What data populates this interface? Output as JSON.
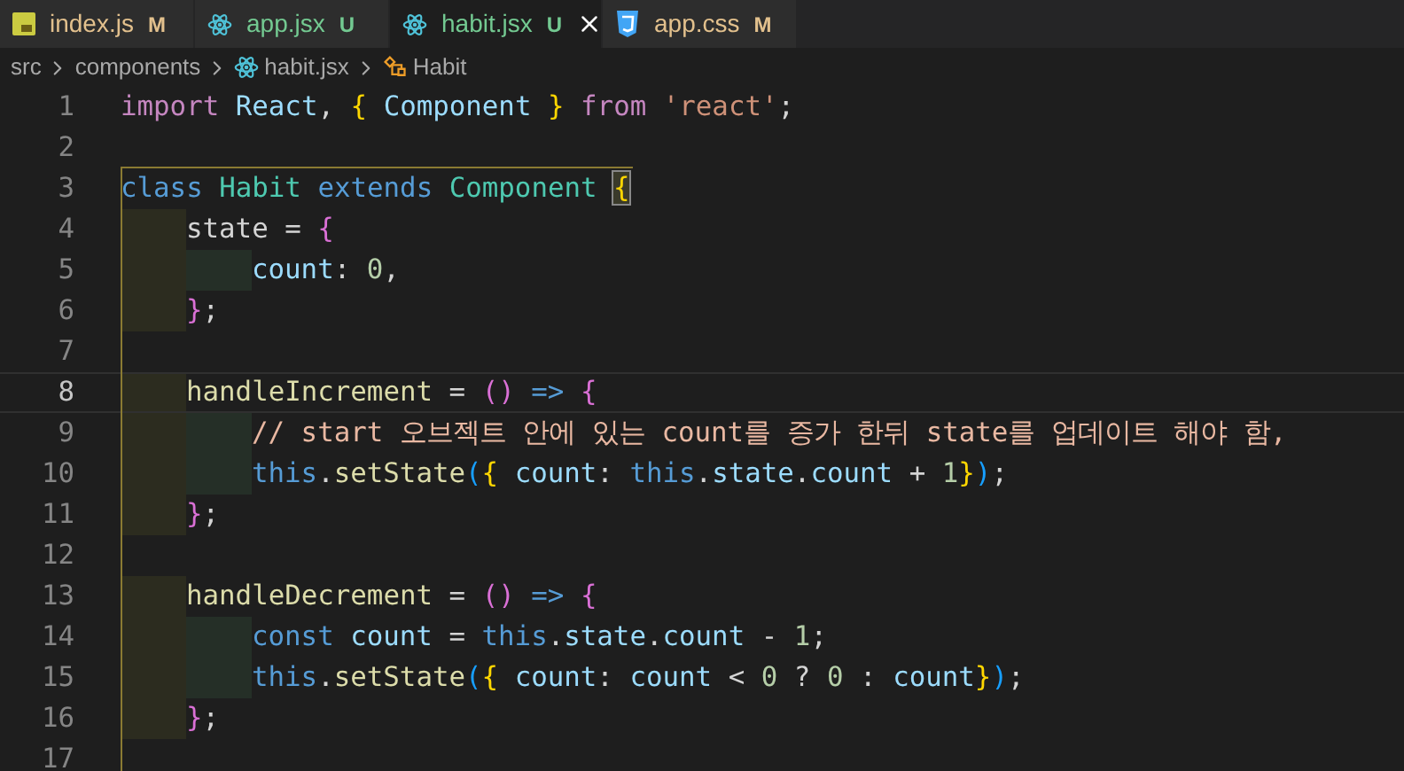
{
  "tabs": [
    {
      "label": "index.js",
      "status": "M",
      "color": "#e2c08d",
      "kind": "js",
      "selected": false
    },
    {
      "label": "app.jsx",
      "status": "U",
      "color": "#73c991",
      "kind": "react",
      "selected": false
    },
    {
      "label": "habit.jsx",
      "status": "U",
      "color": "#73c991",
      "kind": "react",
      "selected": true
    },
    {
      "label": "app.css",
      "status": "M",
      "color": "#e2c08d",
      "kind": "css",
      "selected": false
    }
  ],
  "breadcrumbs": [
    {
      "label": "src",
      "kind": "folder"
    },
    {
      "label": "components",
      "kind": "folder"
    },
    {
      "label": "habit.jsx",
      "kind": "react"
    },
    {
      "label": "Habit",
      "kind": "class"
    }
  ],
  "lines": [
    {
      "number": "1",
      "current": false,
      "tokens": [
        {
          "t": "import ",
          "kind": "kw"
        },
        {
          "t": "React",
          "kind": "var"
        },
        {
          "t": ", ",
          "kind": "pl"
        },
        {
          "t": "{ ",
          "kind": "b1"
        },
        {
          "t": "Component ",
          "kind": "var"
        },
        {
          "t": "} ",
          "kind": "b1"
        },
        {
          "t": "from ",
          "kind": "kw"
        },
        {
          "t": "'react'",
          "kind": "str"
        },
        {
          "t": ";",
          "kind": "pl"
        }
      ]
    },
    {
      "number": "2",
      "current": false
    },
    {
      "number": "3",
      "current": false,
      "tokens": [
        {
          "t": "class ",
          "kind": "st"
        },
        {
          "t": "Habit ",
          "kind": "ty"
        },
        {
          "t": "extends ",
          "kind": "st"
        },
        {
          "t": "Component ",
          "kind": "ty"
        },
        {
          "t": "{",
          "kind": "b1",
          "boxed": true
        }
      ]
    },
    {
      "number": "4",
      "current": false,
      "guides": [
        {
          "color": "#2c2c1f"
        }
      ],
      "tokens": [
        {
          "t": "state = ",
          "kind": "pl"
        },
        {
          "t": "{",
          "kind": "b2"
        }
      ]
    },
    {
      "number": "5",
      "current": false,
      "guides": [
        {
          "color": "#2c2c1f"
        },
        {
          "color": "#252f27"
        }
      ],
      "tokens": [
        {
          "t": "count",
          "kind": "var"
        },
        {
          "t": ": ",
          "kind": "pl"
        },
        {
          "t": "0",
          "kind": "num"
        },
        {
          "t": ",",
          "kind": "pl"
        }
      ]
    },
    {
      "number": "6",
      "current": false,
      "guides": [
        {
          "color": "#2c2c1f"
        }
      ],
      "tokens": [
        {
          "t": "}",
          "kind": "b2"
        },
        {
          "t": ";",
          "kind": "pl"
        }
      ]
    },
    {
      "number": "7",
      "current": false
    },
    {
      "number": "8",
      "current": true,
      "guides": [
        {
          "color": "#2c2c1f"
        }
      ],
      "tokens": [
        {
          "t": "handleIncrement",
          "kind": "fn"
        },
        {
          "t": " = ",
          "kind": "pl"
        },
        {
          "t": "() ",
          "kind": "b2"
        },
        {
          "t": "=> ",
          "kind": "st"
        },
        {
          "t": "{",
          "kind": "b2"
        }
      ]
    },
    {
      "number": "9",
      "current": false,
      "guides": [
        {
          "color": "#2c2c1f"
        },
        {
          "color": "#252f27"
        }
      ],
      "tokens": [
        {
          "t": "// start 오브젝트 안에 있는 count를 증가 한뒤 state를 업데이트 해야 함,",
          "kind": "cm"
        }
      ]
    },
    {
      "number": "10",
      "current": false,
      "guides": [
        {
          "color": "#2c2c1f"
        },
        {
          "color": "#252f27"
        }
      ],
      "tokens": [
        {
          "t": "this",
          "kind": "st"
        },
        {
          "t": ".",
          "kind": "pl"
        },
        {
          "t": "setState",
          "kind": "fn"
        },
        {
          "t": "(",
          "kind": "b3"
        },
        {
          "t": "{ ",
          "kind": "b1"
        },
        {
          "t": "count",
          "kind": "var"
        },
        {
          "t": ": ",
          "kind": "pl"
        },
        {
          "t": "this",
          "kind": "st"
        },
        {
          "t": ".",
          "kind": "pl"
        },
        {
          "t": "state",
          "kind": "var"
        },
        {
          "t": ".",
          "kind": "pl"
        },
        {
          "t": "count",
          "kind": "var"
        },
        {
          "t": " + ",
          "kind": "pl"
        },
        {
          "t": "1",
          "kind": "num"
        },
        {
          "t": "}",
          "kind": "b1"
        },
        {
          "t": ")",
          "kind": "b3"
        },
        {
          "t": ";",
          "kind": "pl"
        }
      ]
    },
    {
      "number": "11",
      "current": false,
      "guides": [
        {
          "color": "#2c2c1f"
        }
      ],
      "tokens": [
        {
          "t": "}",
          "kind": "b2"
        },
        {
          "t": ";",
          "kind": "pl"
        }
      ]
    },
    {
      "number": "12",
      "current": false
    },
    {
      "number": "13",
      "current": false,
      "guides": [
        {
          "color": "#2c2c1f"
        }
      ],
      "tokens": [
        {
          "t": "handleDecrement",
          "kind": "fn"
        },
        {
          "t": " = ",
          "kind": "pl"
        },
        {
          "t": "() ",
          "kind": "b2"
        },
        {
          "t": "=> ",
          "kind": "st"
        },
        {
          "t": "{",
          "kind": "b2"
        }
      ]
    },
    {
      "number": "14",
      "current": false,
      "guides": [
        {
          "color": "#2c2c1f"
        },
        {
          "color": "#252f27"
        }
      ],
      "tokens": [
        {
          "t": "const ",
          "kind": "st"
        },
        {
          "t": "count",
          "kind": "var"
        },
        {
          "t": " = ",
          "kind": "pl"
        },
        {
          "t": "this",
          "kind": "st"
        },
        {
          "t": ".",
          "kind": "pl"
        },
        {
          "t": "state",
          "kind": "var"
        },
        {
          "t": ".",
          "kind": "pl"
        },
        {
          "t": "count",
          "kind": "var"
        },
        {
          "t": " - ",
          "kind": "pl"
        },
        {
          "t": "1",
          "kind": "num"
        },
        {
          "t": ";",
          "kind": "pl"
        }
      ]
    },
    {
      "number": "15",
      "current": false,
      "guides": [
        {
          "color": "#2c2c1f"
        },
        {
          "color": "#252f27"
        }
      ],
      "tokens": [
        {
          "t": "this",
          "kind": "st"
        },
        {
          "t": ".",
          "kind": "pl"
        },
        {
          "t": "setState",
          "kind": "fn"
        },
        {
          "t": "(",
          "kind": "b3"
        },
        {
          "t": "{ ",
          "kind": "b1"
        },
        {
          "t": "count",
          "kind": "var"
        },
        {
          "t": ": ",
          "kind": "pl"
        },
        {
          "t": "count",
          "kind": "var"
        },
        {
          "t": " < ",
          "kind": "pl"
        },
        {
          "t": "0",
          "kind": "num"
        },
        {
          "t": " ? ",
          "kind": "pl"
        },
        {
          "t": "0",
          "kind": "num"
        },
        {
          "t": " : ",
          "kind": "pl"
        },
        {
          "t": "count",
          "kind": "var"
        },
        {
          "t": "}",
          "kind": "b1"
        },
        {
          "t": ")",
          "kind": "b3"
        },
        {
          "t": ";",
          "kind": "pl"
        }
      ]
    },
    {
      "number": "16",
      "current": false,
      "guides": [
        {
          "color": "#2c2c1f"
        }
      ],
      "tokens": [
        {
          "t": "}",
          "kind": "b2"
        },
        {
          "t": ";",
          "kind": "pl"
        }
      ]
    },
    {
      "number": "17",
      "current": false
    }
  ]
}
